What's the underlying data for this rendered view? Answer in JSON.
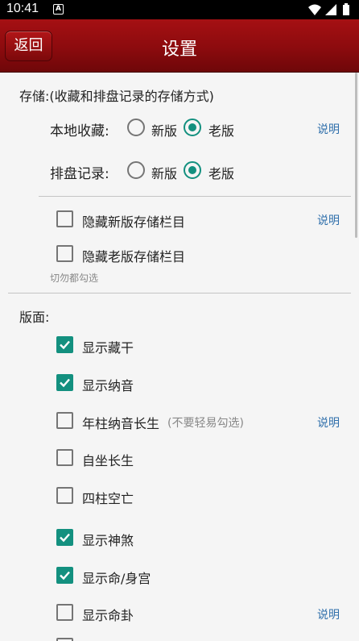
{
  "status": {
    "time": "10:41",
    "notification_glyph": "A"
  },
  "header": {
    "back_label": "返回",
    "title": "设置"
  },
  "storage": {
    "section_label": "存储:(收藏和排盘记录的存储方式)",
    "favorites": {
      "label": "本地收藏:",
      "options": [
        "新版",
        "老版"
      ],
      "selected": "老版",
      "info": "说明"
    },
    "records": {
      "label": "排盘记录:",
      "options": [
        "新版",
        "老版"
      ],
      "selected": "老版"
    },
    "hide_new": {
      "label": "隐藏新版存储栏目",
      "checked": false,
      "info": "说明"
    },
    "hide_old": {
      "label": "隐藏老版存储栏目",
      "checked": false
    },
    "warning": "切勿都勾选"
  },
  "layout": {
    "section_label": "版面:",
    "items": [
      {
        "label": "显示藏干",
        "checked": true
      },
      {
        "label": "显示纳音",
        "checked": true
      },
      {
        "label": "年柱纳音长生",
        "note": "(不要轻易勾选)",
        "checked": false,
        "info": "说明"
      },
      {
        "label": "自坐长生",
        "checked": false
      },
      {
        "label": "四柱空亡",
        "checked": false
      },
      {
        "label": "显示神煞",
        "checked": true
      },
      {
        "label": "显示命/身宫",
        "checked": true
      },
      {
        "label": "显示命卦",
        "checked": false,
        "info": "说明"
      }
    ]
  },
  "colors": {
    "accent": "#13907f",
    "header": "#8c0b0e",
    "link": "#2f6fab"
  }
}
